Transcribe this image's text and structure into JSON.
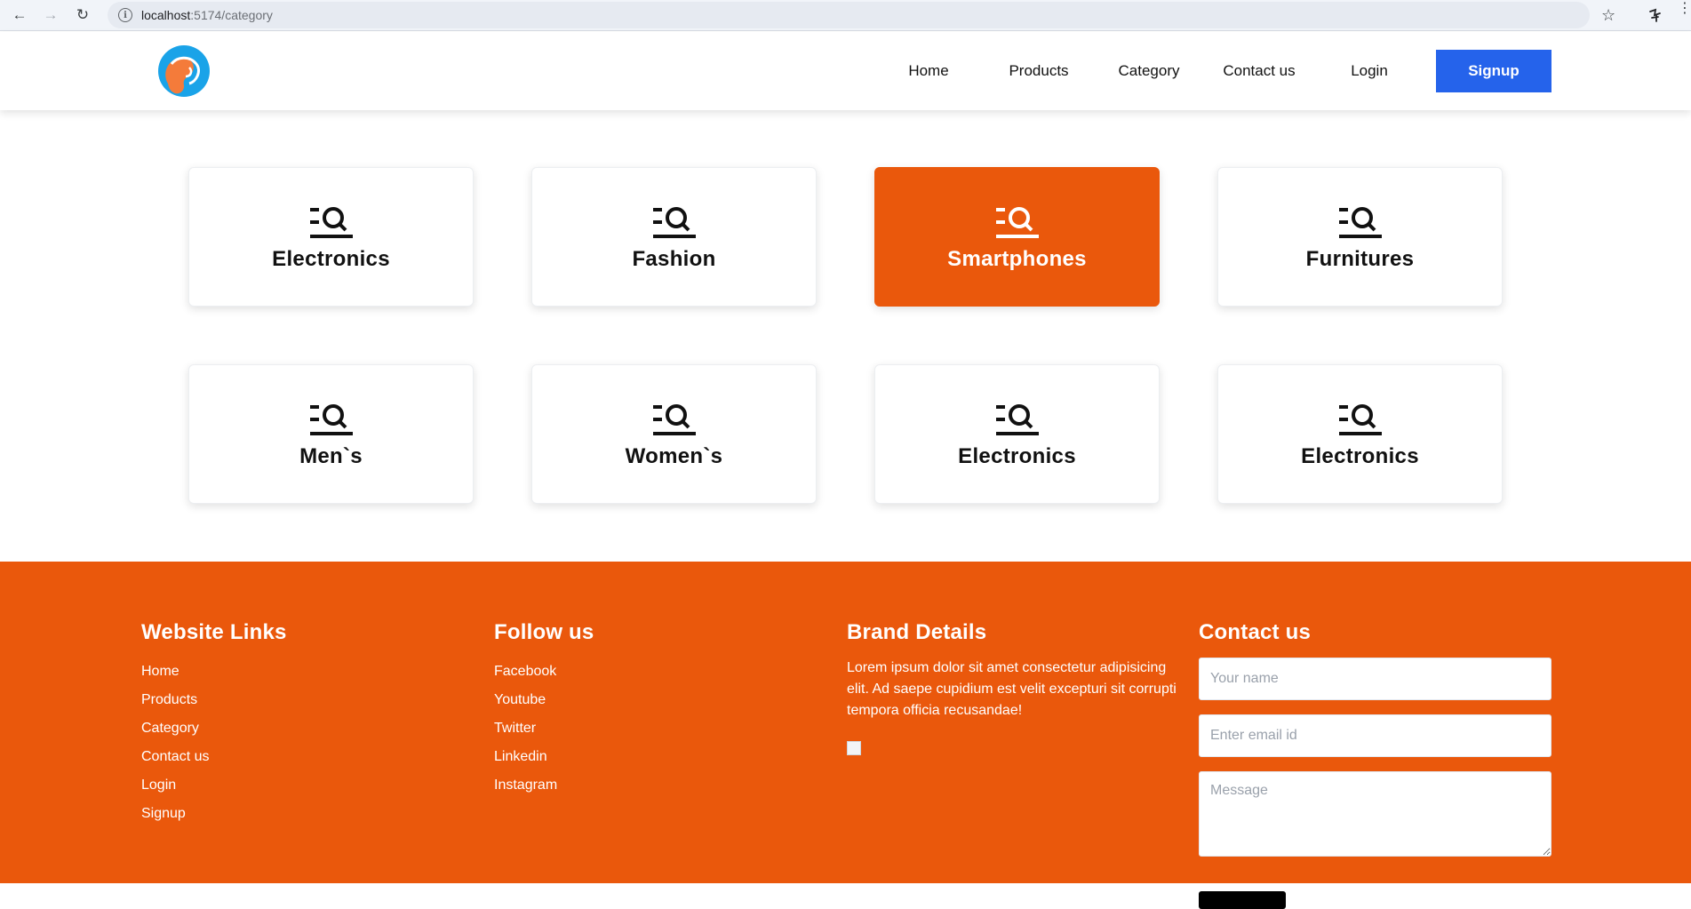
{
  "browser": {
    "url_host": "localhost",
    "url_path": ":5174/category"
  },
  "header": {
    "nav": [
      "Home",
      "Products",
      "Category",
      "Contact us",
      "Login"
    ],
    "signup_label": "Signup",
    "signup_color": "#2563eb"
  },
  "categories": [
    {
      "label": "Electronics",
      "active": false
    },
    {
      "label": "Fashion",
      "active": false
    },
    {
      "label": "Smartphones",
      "active": true
    },
    {
      "label": "Furnitures",
      "active": false
    },
    {
      "label": "Men`s",
      "active": false
    },
    {
      "label": "Women`s",
      "active": false
    },
    {
      "label": "Electronics",
      "active": false
    },
    {
      "label": "Electronics",
      "active": false
    }
  ],
  "accent_color": "#ea580c",
  "footer": {
    "links": {
      "heading": "Website Links",
      "items": [
        "Home",
        "Products",
        "Category",
        "Contact us",
        "Login",
        "Signup"
      ]
    },
    "follow": {
      "heading": "Follow us",
      "items": [
        "Facebook",
        "Youtube",
        "Twitter",
        "Linkedin",
        "Instagram"
      ]
    },
    "brand": {
      "heading": "Brand Details",
      "text": "Lorem ipsum dolor sit amet consectetur adipisicing elit. Ad saepe cupidium est velit excepturi sit corrupti tempora officia recusandae!"
    },
    "contact": {
      "heading": "Contact us",
      "name_placeholder": "Your name",
      "email_placeholder": "Enter email id",
      "message_placeholder": "Message"
    }
  }
}
